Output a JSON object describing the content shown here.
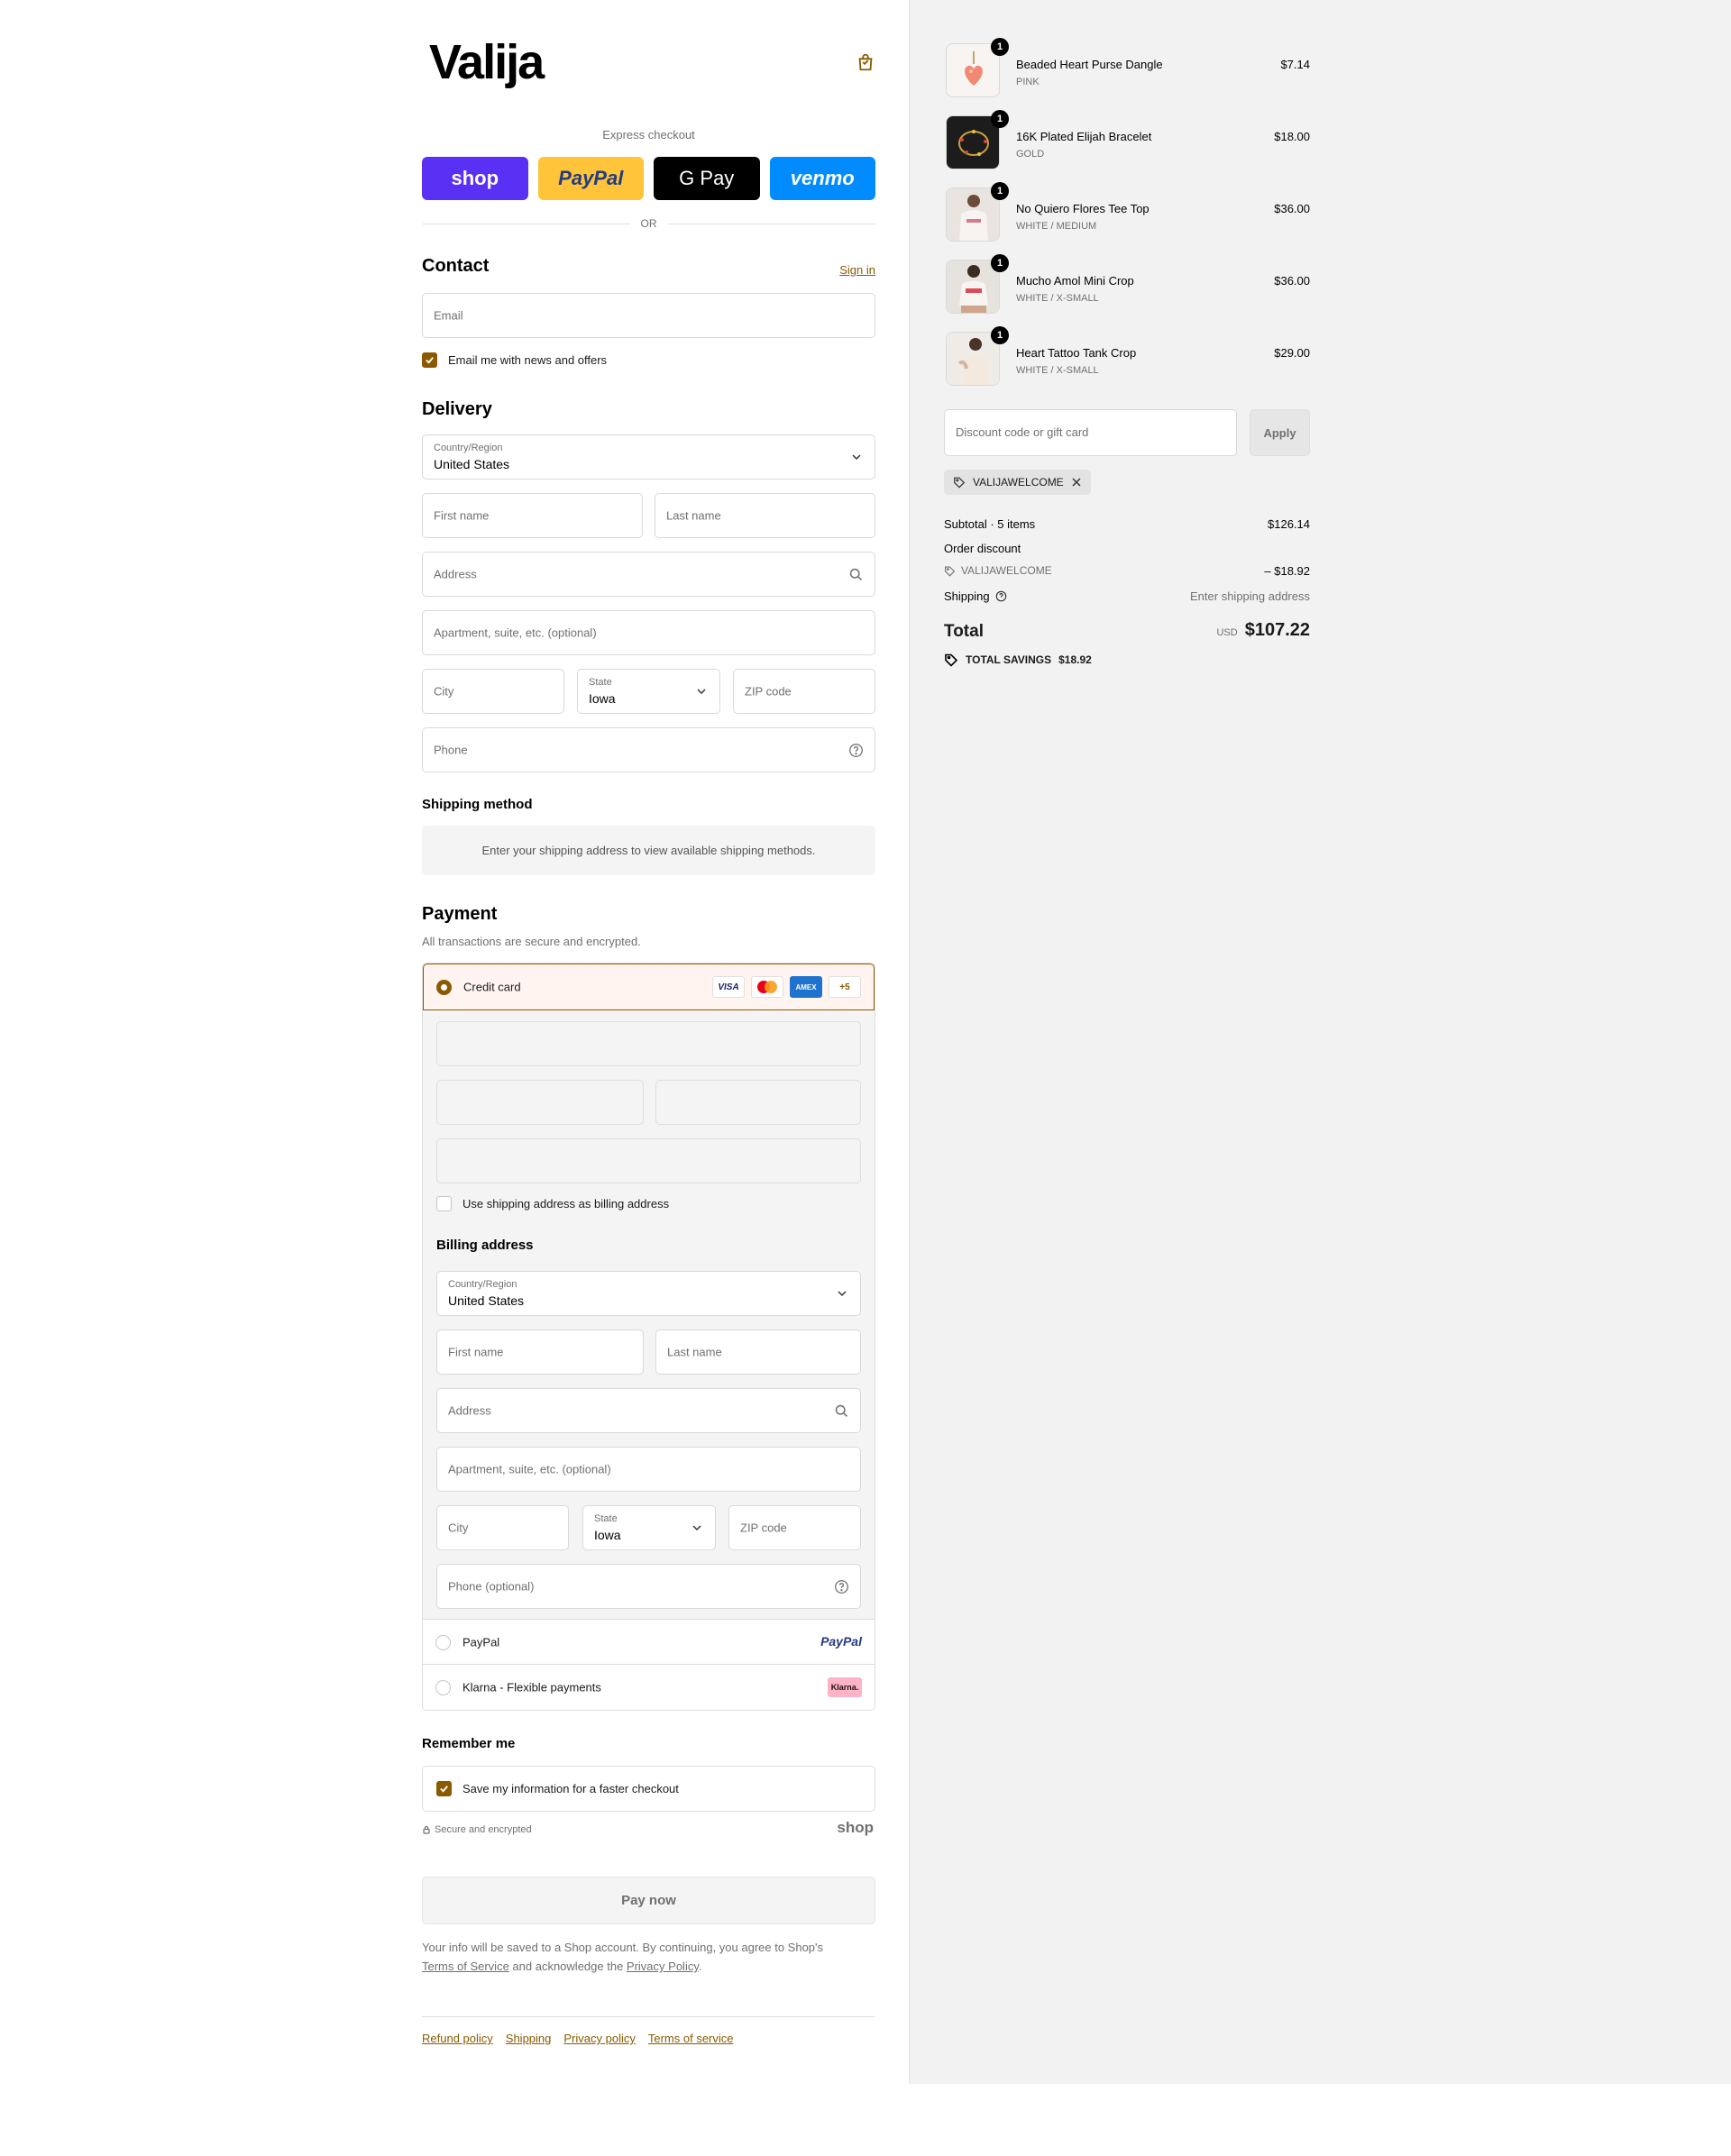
{
  "brand": {
    "logo_text": "Valija",
    "accent": "#8a5a00"
  },
  "express": {
    "label": "Express checkout",
    "buttons": {
      "shop": "shop",
      "paypal": "PayPal",
      "gpay": "G Pay",
      "venmo": "venmo"
    },
    "or": "OR"
  },
  "contact": {
    "title": "Contact",
    "sign_in": "Sign in",
    "email_placeholder": "Email",
    "newsletter_label": "Email me with news and offers"
  },
  "delivery": {
    "title": "Delivery",
    "country_label": "Country/Region",
    "country_value": "United States",
    "first_name": "First name",
    "last_name": "Last name",
    "address": "Address",
    "apartment": "Apartment, suite, etc. (optional)",
    "city": "City",
    "state_label": "State",
    "state_value": "Iowa",
    "zip": "ZIP code",
    "phone": "Phone"
  },
  "shipping_method": {
    "title": "Shipping method",
    "notice": "Enter your shipping address to view available shipping methods."
  },
  "payment": {
    "title": "Payment",
    "subtitle": "All transactions are secure and encrypted.",
    "credit_card_label": "Credit card",
    "card_logos": {
      "visa": "VISA",
      "amex": "AMEX",
      "more": "+5"
    },
    "use_shipping_label": "Use shipping address as billing address",
    "billing_title": "Billing address",
    "billing": {
      "country_label": "Country/Region",
      "country_value": "United States",
      "first_name": "First name",
      "last_name": "Last name",
      "address": "Address",
      "apartment": "Apartment, suite, etc. (optional)",
      "city": "City",
      "state_label": "State",
      "state_value": "Iowa",
      "zip": "ZIP code",
      "phone": "Phone (optional)"
    },
    "paypal_label": "PayPal",
    "paypal_logo": "PayPal",
    "klarna_label": "Klarna - Flexible payments",
    "klarna_logo": "Klarna."
  },
  "remember": {
    "title": "Remember me",
    "save_label": "Save my information for a faster checkout",
    "secure_text": "Secure and encrypted",
    "shop_mark": "shop"
  },
  "pay_now": "Pay now",
  "consent": {
    "part1": "Your info will be saved to a Shop account. By continuing, you agree to Shop's",
    "tos": "Terms of Service",
    "part2": " and acknowledge the ",
    "privacy": "Privacy Policy",
    "part3": "."
  },
  "footer": {
    "links": [
      "Refund policy",
      "Shipping",
      "Privacy policy",
      "Terms of service"
    ]
  },
  "order": {
    "items": [
      {
        "qty": "1",
        "name": "Beaded Heart Purse Dangle",
        "variant": "PINK",
        "price": "$7.14"
      },
      {
        "qty": "1",
        "name": "16K Plated Elijah Bracelet",
        "variant": "GOLD",
        "price": "$18.00"
      },
      {
        "qty": "1",
        "name": "No Quiero Flores Tee Top",
        "variant": "WHITE / MEDIUM",
        "price": "$36.00"
      },
      {
        "qty": "1",
        "name": "Mucho Amol Mini Crop",
        "variant": "WHITE / X-SMALL",
        "price": "$36.00"
      },
      {
        "qty": "1",
        "name": "Heart Tattoo Tank Crop",
        "variant": "WHITE / X-SMALL",
        "price": "$29.00"
      }
    ],
    "discount_placeholder": "Discount code or gift card",
    "apply": "Apply",
    "applied_code": "VALIJAWELCOME",
    "subtotal_label": "Subtotal · 5 items",
    "subtotal_value": "$126.14",
    "order_discount_label": "Order discount",
    "discount_code": "VALIJAWELCOME",
    "discount_value": "– $18.92",
    "shipping_label": "Shipping",
    "shipping_value": "Enter shipping address",
    "total_label": "Total",
    "currency": "USD",
    "total_value": "$107.22",
    "savings_label": "TOTAL SAVINGS",
    "savings_value": "$18.92"
  }
}
